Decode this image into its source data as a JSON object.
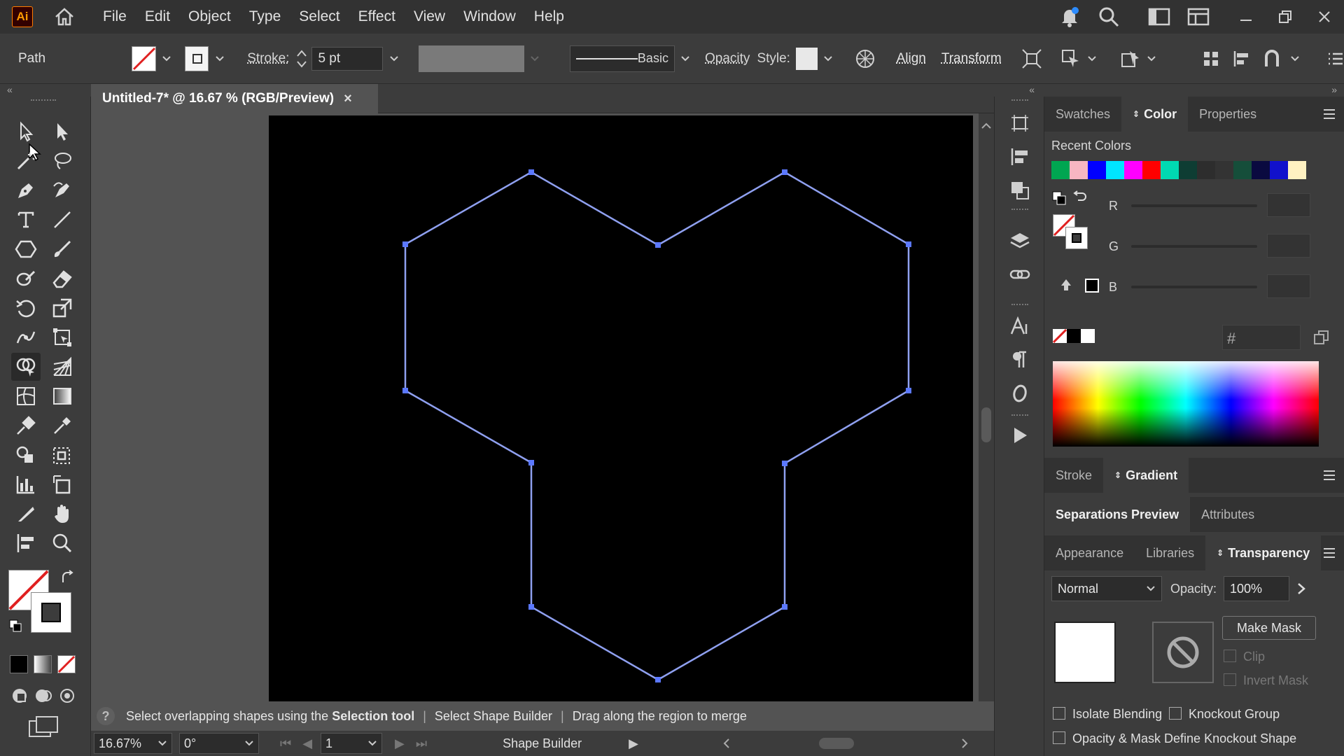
{
  "app": {
    "logo": "Ai",
    "menu": [
      "File",
      "Edit",
      "Object",
      "Type",
      "Select",
      "Effect",
      "View",
      "Window",
      "Help"
    ]
  },
  "control_bar": {
    "selection_type": "Path",
    "stroke_label": "Stroke:",
    "stroke_weight": "5 pt",
    "brush_label": "Basic",
    "opacity_label": "Opacity",
    "style_label": "Style:",
    "align_label": "Align",
    "transform_label": "Transform"
  },
  "document": {
    "tab_title": "Untitled-7* @ 16.67 % (RGB/Preview)",
    "close_glyph": "×"
  },
  "shape": {
    "stroke_color": "#8fa0f0",
    "anchor_color": "#5b78ff",
    "background": "#000000"
  },
  "status": {
    "help_glyph": "?",
    "hint_part1": "Select overlapping shapes using the ",
    "hint_bold": "Selection tool",
    "hint_part2": "Select Shape Builder",
    "hint_part3": "Drag along the region to merge",
    "separator": "|"
  },
  "bottom_bar": {
    "zoom": "16.67%",
    "rotation": "0°",
    "artboard": "1",
    "tool_name": "Shape Builder"
  },
  "color_panel": {
    "tabs": [
      "Swatches",
      "Color",
      "Properties"
    ],
    "active_tab": "Color",
    "recent_colors_label": "Recent Colors",
    "recent_colors": [
      "#00a651",
      "#f7b6c2",
      "#0000ff",
      "#00e5ff",
      "#ff00ff",
      "#ff0000",
      "#00d9b2",
      "#0e3d33",
      "#2d2d2d",
      "#333333",
      "#154e3a",
      "#0a0a40",
      "#1111cc",
      "#fff2c2"
    ],
    "channels": [
      "R",
      "G",
      "B"
    ],
    "hex_label": "#"
  },
  "stroke_panel": {
    "tabs": [
      "Stroke",
      "Gradient"
    ],
    "active_tab": "Gradient"
  },
  "separations_panel": {
    "tabs": [
      "Separations Preview",
      "Attributes"
    ],
    "active_tab": "Separations Preview"
  },
  "transparency_panel": {
    "tabs": [
      "Appearance",
      "Libraries",
      "Transparency"
    ],
    "active_tab": "Transparency",
    "blend_mode": "Normal",
    "opacity_label": "Opacity:",
    "opacity_value": "100%",
    "make_mask_label": "Make Mask",
    "clip_label": "Clip",
    "invert_mask_label": "Invert Mask",
    "isolate_blending_label": "Isolate Blending",
    "knockout_group_label": "Knockout Group",
    "opacity_mask_label": "Opacity & Mask Define Knockout Shape"
  }
}
